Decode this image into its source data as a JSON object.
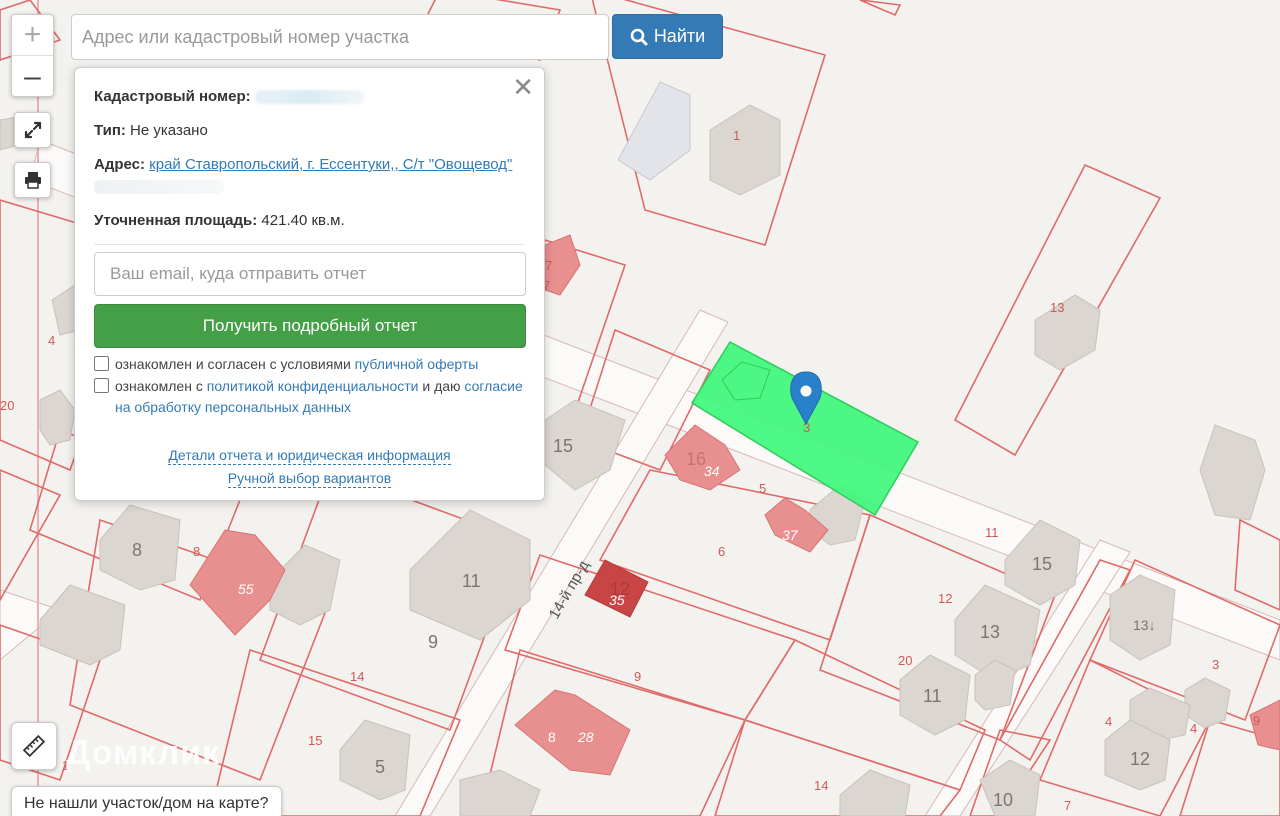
{
  "controls": {
    "zoom_in": "+",
    "zoom_out": "–"
  },
  "search": {
    "placeholder": "Адрес или кадастровый номер участка",
    "button_label": "Найти"
  },
  "popup": {
    "cadastral_label": "Кадастровый номер:",
    "type_label": "Тип:",
    "type_value": "Не указано",
    "address_label": "Адрес:",
    "address_value": "край Ставропольский, г. Ессентуки,, С/т \"Овощевод\"",
    "area_label": "Уточненная площадь:",
    "area_value": "421.40 кв.м.",
    "email_placeholder": "Ваш email, куда отправить отчет",
    "report_button": "Получить подробный отчет",
    "consent1_text": "ознакомлен и согласен с условиями",
    "consent1_link": "публичной оферты",
    "consent2_text_a": "ознакомлен с",
    "consent2_link1": "политикой конфиденциальности",
    "consent2_text_b": "и даю",
    "consent2_link2": "согласие на обработку персональных данных",
    "details_link": "Детали отчета и юридическая информация",
    "manual_link": "Ручной выбор вариантов"
  },
  "not_found": "Не нашли участок/дом на карте?",
  "watermark": "Домклик",
  "map": {
    "street_label": "14-й пр-д",
    "selected_color": "#3ef77a",
    "boundary_color": "#e06a6a",
    "marker_color": "#2a81cb"
  }
}
